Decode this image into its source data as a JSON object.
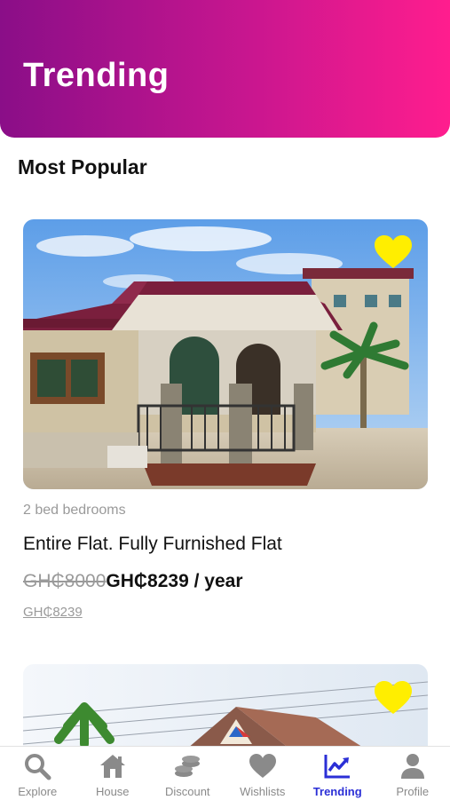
{
  "header": {
    "title": "Trending"
  },
  "section": {
    "title": "Most Popular"
  },
  "listings": [
    {
      "bedrooms": "2 bed  bedrooms",
      "title": "Entire Flat. Fully Furnished Flat",
      "old_price": "GH₵8000",
      "price": "GH₵8239 / year",
      "price_link": "GH₵8239",
      "favorited": true
    },
    {
      "favorited": true
    }
  ],
  "tabbar": {
    "items": [
      {
        "label": "Explore",
        "icon": "search-icon",
        "active": false
      },
      {
        "label": "House",
        "icon": "house-icon",
        "active": false
      },
      {
        "label": "Discount",
        "icon": "coins-icon",
        "active": false
      },
      {
        "label": "Wishlists",
        "icon": "heart-icon",
        "active": false
      },
      {
        "label": "Trending",
        "icon": "trending-chart-icon",
        "active": true
      },
      {
        "label": "Profile",
        "icon": "person-icon",
        "active": false
      }
    ]
  },
  "colors": {
    "header_gradient_start": "#8a0e88",
    "header_gradient_end": "#ff1d8e",
    "active_tab": "#2b2fd6",
    "inactive_tab": "#8a8a8a",
    "favorite_heart": "#ffee00"
  }
}
